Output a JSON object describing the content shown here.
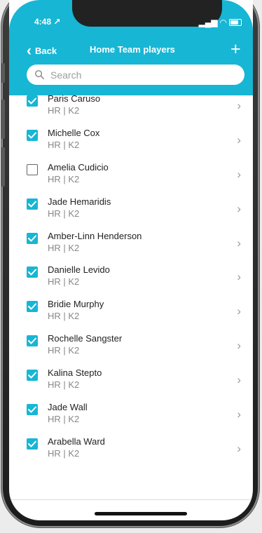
{
  "status": {
    "time": "4:48 ↗"
  },
  "header": {
    "back_label": "Back",
    "title": "Home Team players",
    "add_label": "+"
  },
  "search": {
    "placeholder": "Search"
  },
  "players": [
    {
      "name": "Paris Caruso",
      "details": "HR | K2",
      "checked": true
    },
    {
      "name": "Michelle Cox",
      "details": "HR | K2",
      "checked": true
    },
    {
      "name": "Amelia Cudicio",
      "details": "HR | K2",
      "checked": false
    },
    {
      "name": "Jade Hemaridis",
      "details": "HR | K2",
      "checked": true
    },
    {
      "name": "Amber-Linn Henderson",
      "details": "HR | K2",
      "checked": true
    },
    {
      "name": "Danielle Levido",
      "details": "HR | K2",
      "checked": true
    },
    {
      "name": "Bridie Murphy",
      "details": "HR | K2",
      "checked": true
    },
    {
      "name": "Rochelle Sangster",
      "details": "HR | K2",
      "checked": true
    },
    {
      "name": "Kalina Stepto",
      "details": "HR | K2",
      "checked": true
    },
    {
      "name": "Jade Wall",
      "details": "HR | K2",
      "checked": true
    },
    {
      "name": "Arabella Ward",
      "details": "HR | K2",
      "checked": true
    }
  ],
  "colors": {
    "accent": "#17b6d5"
  }
}
